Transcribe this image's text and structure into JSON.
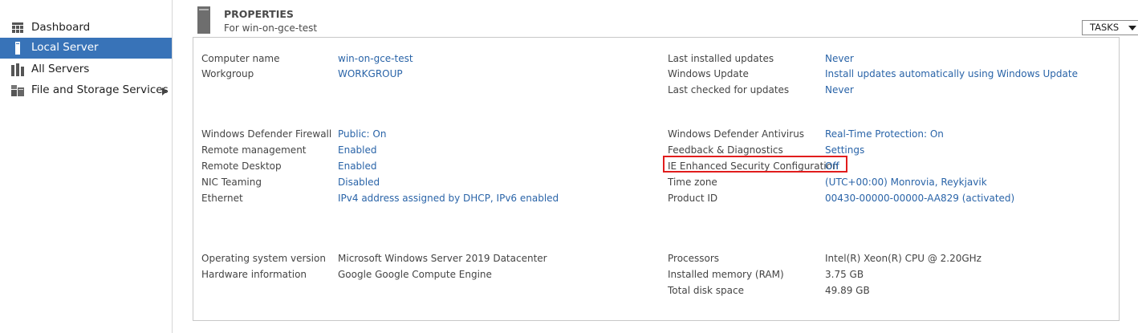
{
  "sidebar": {
    "items": [
      {
        "label": "Dashboard",
        "icon": "dashboard-grid-icon",
        "selected": false
      },
      {
        "label": "Local Server",
        "icon": "server-icon",
        "selected": true
      },
      {
        "label": "All Servers",
        "icon": "servers-icon",
        "selected": false
      },
      {
        "label": "File and Storage Services",
        "icon": "storage-icon",
        "selected": false,
        "has_submenu": true
      }
    ]
  },
  "properties": {
    "title": "PROPERTIES",
    "subtitle": "For win-on-gce-test",
    "tasks_label": "TASKS",
    "left": [
      {
        "label": "Computer name",
        "value": "win-on-gce-test"
      },
      {
        "label": "Workgroup",
        "value": "WORKGROUP"
      },
      {
        "label": "Windows Defender Firewall",
        "value": "Public: On"
      },
      {
        "label": "Remote management",
        "value": "Enabled"
      },
      {
        "label": "Remote Desktop",
        "value": "Enabled"
      },
      {
        "label": "NIC Teaming",
        "value": "Disabled"
      },
      {
        "label": "Ethernet",
        "value": "IPv4 address assigned by DHCP, IPv6 enabled"
      },
      {
        "label": "Operating system version",
        "value": "Microsoft Windows Server 2019 Datacenter"
      },
      {
        "label": "Hardware information",
        "value": "Google Google Compute Engine"
      }
    ],
    "right": [
      {
        "label": "Last installed updates",
        "value": "Never"
      },
      {
        "label": "Windows Update",
        "value": "Install updates automatically using Windows Update"
      },
      {
        "label": "Last checked for updates",
        "value": "Never"
      },
      {
        "label": "Windows Defender Antivirus",
        "value": "Real-Time Protection: On"
      },
      {
        "label": "Feedback & Diagnostics",
        "value": "Settings"
      },
      {
        "label": "IE Enhanced Security Configuration",
        "value": "Off"
      },
      {
        "label": "Time zone",
        "value": "(UTC+00:00) Monrovia, Reykjavik"
      },
      {
        "label": "Product ID",
        "value": "00430-00000-00000-AA829 (activated)"
      },
      {
        "label": "Processors",
        "value": "Intel(R) Xeon(R) CPU @ 2.20GHz"
      },
      {
        "label": "Installed memory (RAM)",
        "value": "3.75 GB"
      },
      {
        "label": "Total disk space",
        "value": "49.89 GB"
      }
    ]
  },
  "colors": {
    "selected_nav": "#3873b8",
    "link": "#2a64a8",
    "highlight": "#e11d1d"
  }
}
